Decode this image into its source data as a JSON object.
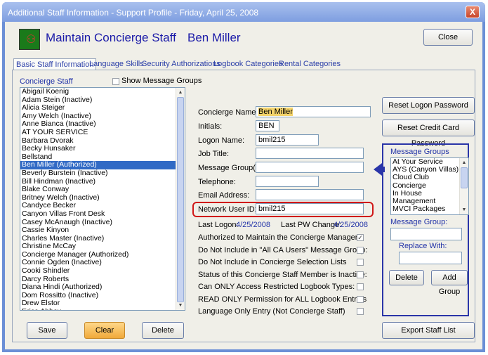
{
  "window": {
    "title": "Additional Staff Information - Support Profile - Friday, April 25, 2008",
    "close_glyph": "X"
  },
  "header": {
    "title": "Maintain Concierge Staff",
    "staff_name": "Ben Miller",
    "close_label": "Close"
  },
  "tabs": [
    {
      "label": "Basic Staff Information",
      "active": true
    },
    {
      "label": "Language Skills"
    },
    {
      "label": "Security Authorizations"
    },
    {
      "label": "Logbook Categories"
    },
    {
      "label": "Rental Categories"
    }
  ],
  "staff_list": {
    "label": "Concierge Staff",
    "show_groups_label": "Show Message Groups",
    "selected": "Ben Miller  (Authorized)",
    "items": [
      "Abigail Koenig",
      "Adam Stein  (Inactive)",
      "Alicia Steiger",
      "Amy Welch  (Inactive)",
      "Anne Bianca  (Inactive)",
      "AT YOUR SERVICE",
      "Barbara Dvorak",
      "Becky Hunsaker",
      "Bellstand",
      "Ben Miller  (Authorized)",
      "Beverly Burstein  (Inactive)",
      "Bill Hindman  (Inactive)",
      "Blake Conway",
      "Britney Welch  (Inactive)",
      "Candyce Becker",
      "Canyon Villas Front Desk",
      "Casey McAnaugh  (Inactive)",
      "Cassie Kinyon",
      "Charles Master  (Inactive)",
      "Christine McCay",
      "Concierge Manager  (Authorized)",
      "Connie Ogden  (Inactive)",
      "Cooki Shindler",
      "Darcy Roberts",
      "Diana Hindi  (Authorized)",
      "Dom Rossitto  (Inactive)",
      "Drew Elstor",
      "Erica Abbey"
    ]
  },
  "form": {
    "concierge_name_label": "Concierge Name:",
    "concierge_name": "Ben Miller",
    "initials_label": "Initials:",
    "initials": "BEN",
    "logon_label": "Logon Name:",
    "logon": "bmil215",
    "job_title_label": "Job Title:",
    "job_title": "",
    "msg_groups_label": "Message Group(s):",
    "msg_groups": "",
    "telephone_label": "Telephone:",
    "telephone": "",
    "email_label": "Email Address:",
    "email": "",
    "network_label": "Network User ID:",
    "network": "bmil215",
    "last_logon_label": "Last Logon:",
    "last_logon": "4/25/2008",
    "last_pw_label": "Last PW Change:",
    "last_pw": "4/25/2008"
  },
  "options": [
    {
      "label": "Authorized to Maintain the Concierge Manager:",
      "checked": true
    },
    {
      "label": "Do Not Include in \"All CA Users\" Message Group:",
      "checked": false
    },
    {
      "label": "Do Not Include in Concierge Selection Lists",
      "checked": false
    },
    {
      "label": "Status of this Concierge Staff Member is Inactive:",
      "checked": false
    },
    {
      "label": "Can ONLY Access Restricted Logbook Types:",
      "checked": false
    },
    {
      "label": "READ ONLY Permission for ALL Logbook Entries",
      "checked": false
    },
    {
      "label": "Language Only Entry (Not Concierge Staff)",
      "checked": false
    }
  ],
  "right": {
    "reset_logon": "Reset Logon Password",
    "reset_credit": "Reset Credit Card Password",
    "mg_title": "Message Groups",
    "mg_items": [
      "At Your Service",
      "AYS (Canyon Villas)",
      "Cloud Club",
      "Concierge",
      "In House",
      "Management",
      "MVCI Packages"
    ],
    "mg_group_label": "Message Group:",
    "replace_label": "Replace With:",
    "delete_label": "Delete",
    "add_group_label": "Add Group",
    "export_label": "Export Staff List"
  },
  "bottom": {
    "save": "Save",
    "clear": "Clear",
    "delete": "Delete"
  },
  "colors": {
    "title_blue": "#1a1aa8",
    "selection": "#316ac5",
    "highlight": "#f4d36a",
    "callout": "#d01818"
  }
}
